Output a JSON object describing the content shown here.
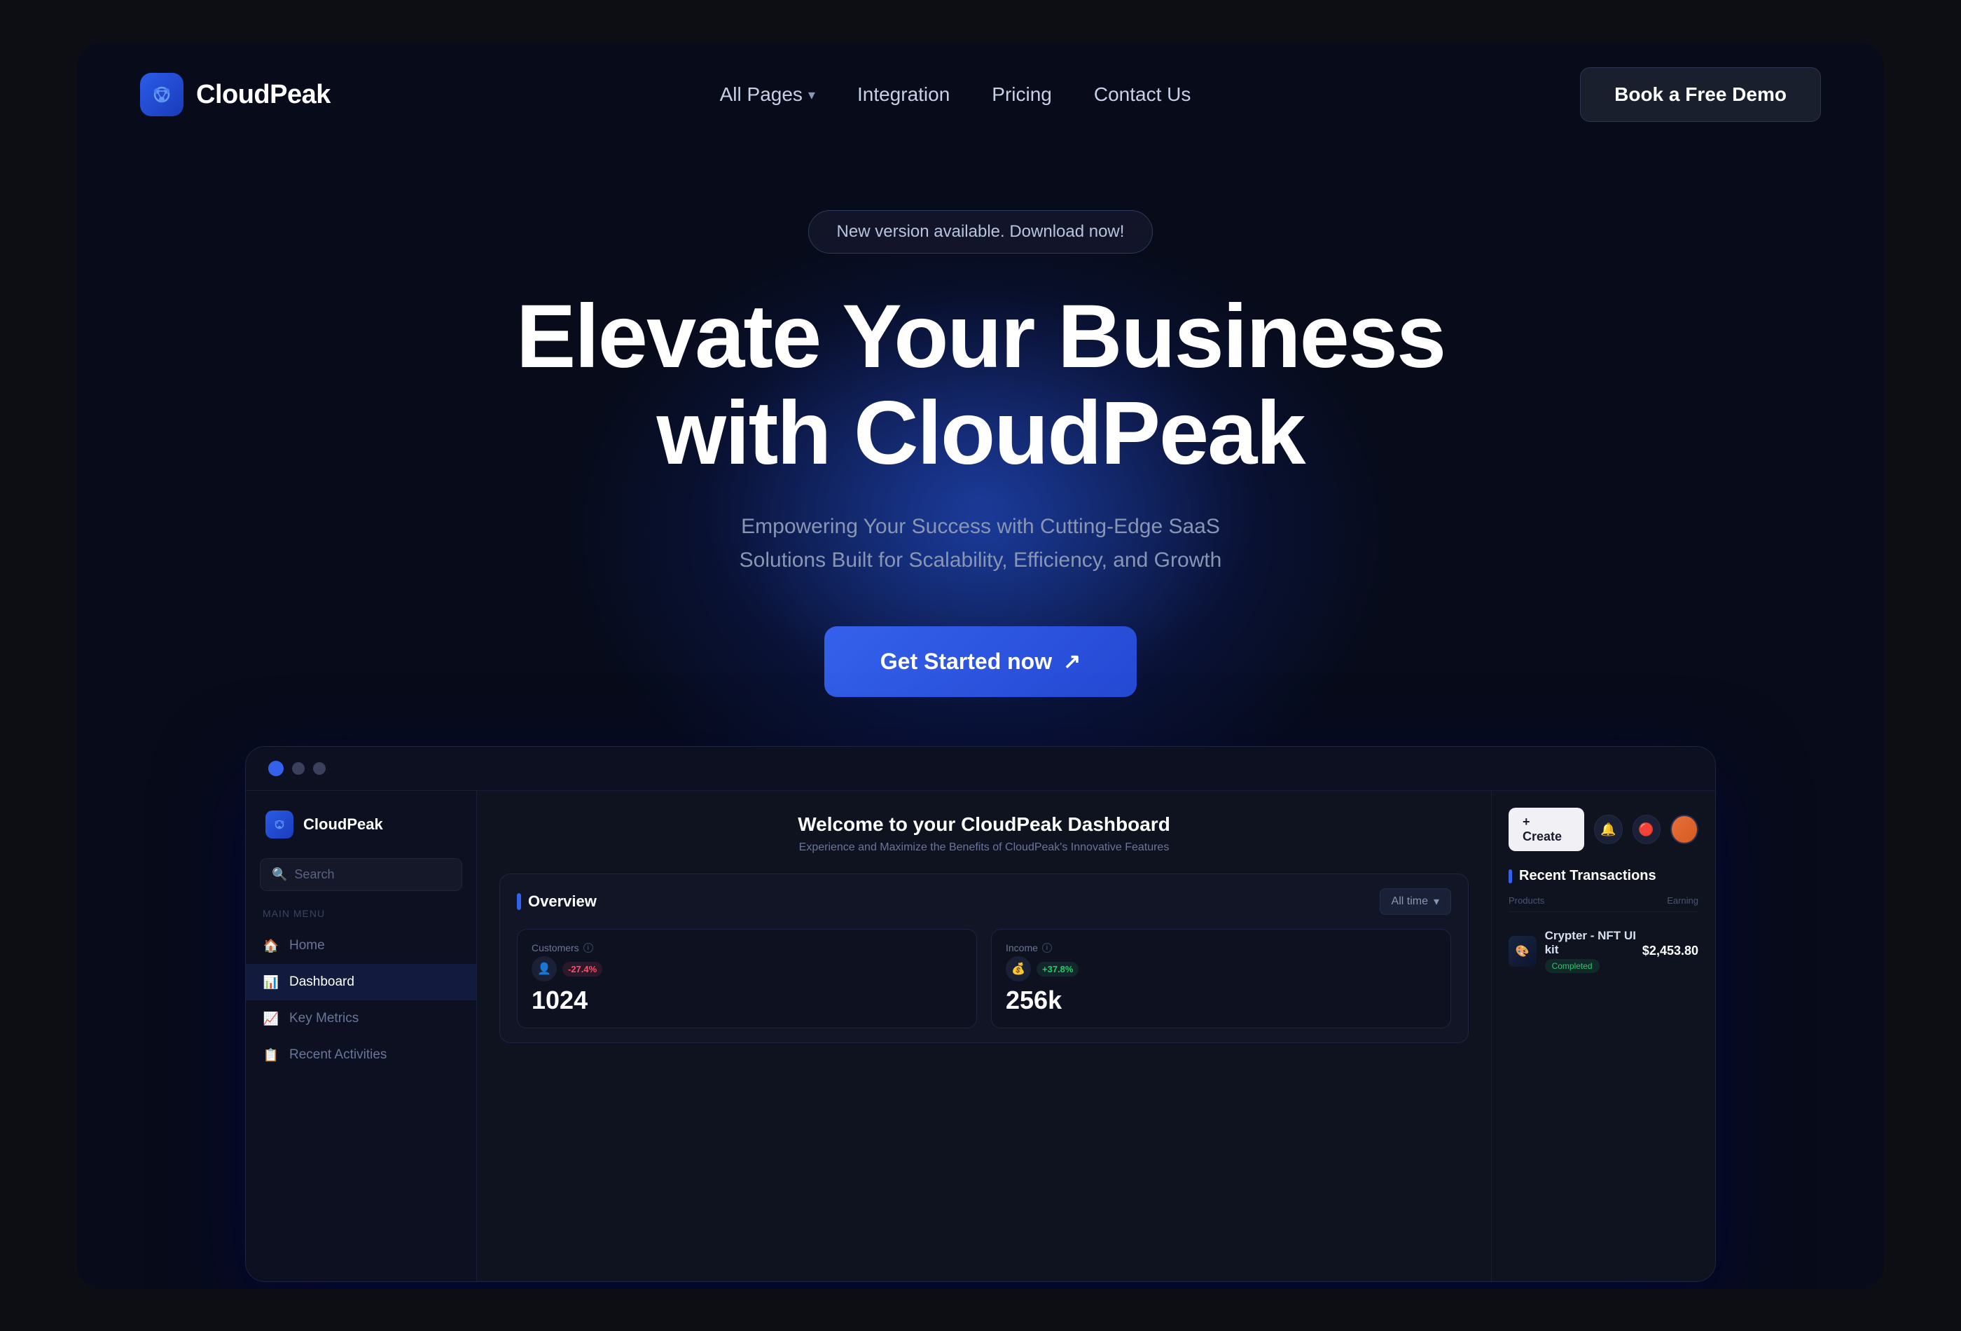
{
  "page": {
    "bg_color": "#070b1a"
  },
  "navbar": {
    "logo_text": "CloudPeak",
    "nav_links": [
      {
        "label": "All Pages",
        "has_dropdown": true
      },
      {
        "label": "Integration",
        "has_dropdown": false
      },
      {
        "label": "Pricing",
        "has_dropdown": false
      },
      {
        "label": "Contact Us",
        "has_dropdown": false
      }
    ],
    "cta_label": "Book a Free Demo"
  },
  "hero": {
    "badge_text": "New version available. Download now!",
    "title_line1": "Elevate Your Business",
    "title_line2": "with CloudPeak",
    "subtitle": "Empowering Your Success with Cutting-Edge SaaS Solutions Built for Scalability, Efficiency, and Growth",
    "cta_label": "Get Started now",
    "cta_arrow": "↗"
  },
  "dashboard": {
    "logo": "CloudPeak",
    "search_placeholder": "Search",
    "menu_label": "Main Menu",
    "menu_items": [
      {
        "label": "Home",
        "icon": "🏠",
        "active": false
      },
      {
        "label": "Dashboard",
        "icon": "📊",
        "active": true
      },
      {
        "label": "Key Metrics",
        "icon": "📈",
        "active": false
      },
      {
        "label": "Recent Activities",
        "icon": "📋",
        "active": false
      }
    ],
    "welcome_title": "Welcome to your CloudPeak Dashboard",
    "welcome_sub": "Experience and Maximize the Benefits of CloudPeak's Innovative Features",
    "overview_title": "Overview",
    "time_filter": "All time",
    "metrics": [
      {
        "label": "Customers",
        "value": "1024",
        "change": "-27.4%",
        "change_type": "down",
        "icon": "👤"
      },
      {
        "label": "Income",
        "value": "256k",
        "change": "+37.8%",
        "change_type": "up",
        "icon": "💰"
      }
    ],
    "top_bar": {
      "create_label": "+ Create"
    },
    "transactions": {
      "title": "Recent Transactions",
      "col_products": "Products",
      "col_earning": "Earning",
      "items": [
        {
          "name": "Crypter - NFT UI kit",
          "amount": "$2,453.80",
          "status": "Completed",
          "status_type": "success"
        }
      ]
    }
  }
}
